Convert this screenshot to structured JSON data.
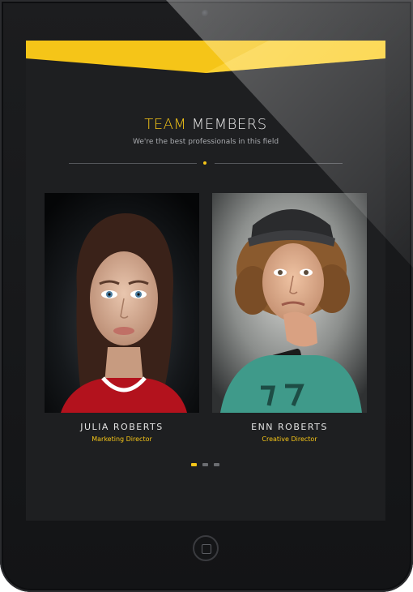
{
  "section": {
    "title_accent": "TEAM",
    "title_rest": "MEMBERS",
    "subtitle": "We're the best professionals in this field"
  },
  "members": [
    {
      "name": "JULIA ROBERTS",
      "role": "Marketing Director"
    },
    {
      "name": "ENN ROBERTS",
      "role": "Creative Director"
    }
  ],
  "carousel": {
    "pages": 3,
    "active_page": 1
  },
  "colors": {
    "accent": "#f5c518",
    "screen_bg": "#1e1f21",
    "device": "#1c1d1f"
  }
}
